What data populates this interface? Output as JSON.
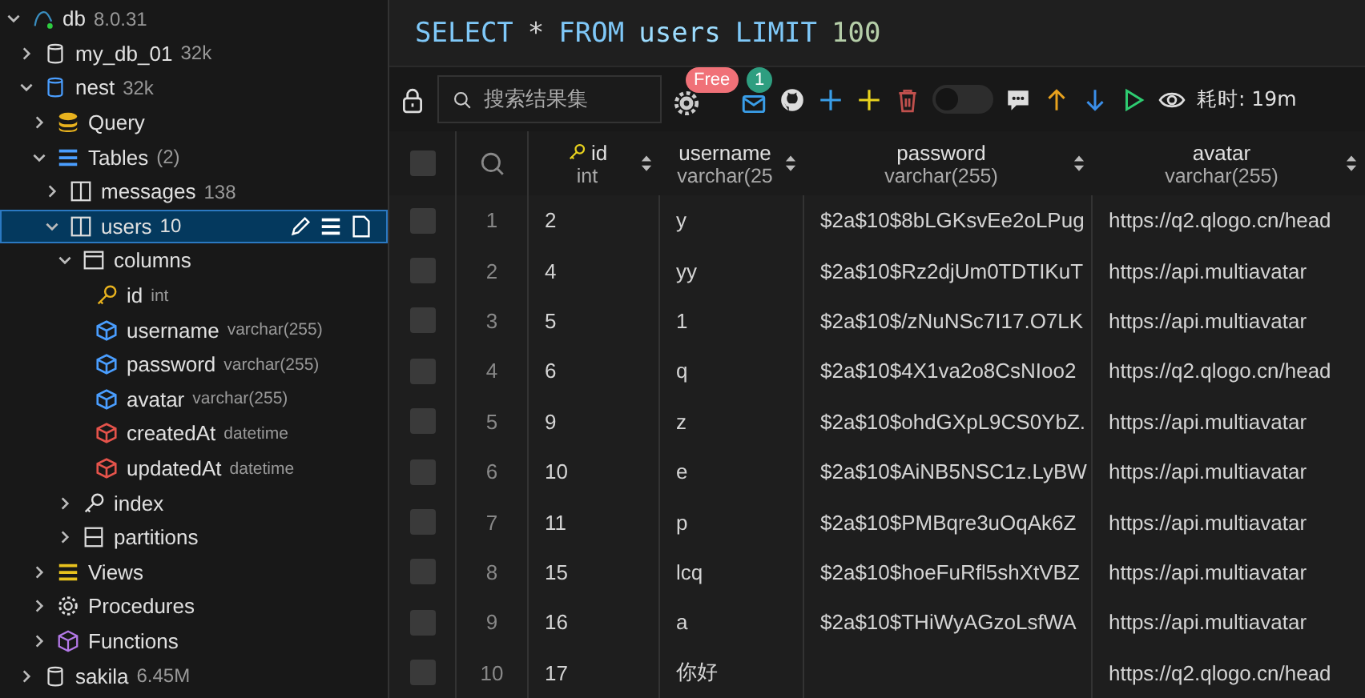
{
  "tree": [
    {
      "label": "db",
      "meta": "8.0.31",
      "kind": "server",
      "expanded": true,
      "selected": false,
      "children": [
        {
          "label": "my_db_01",
          "meta": "32k",
          "kind": "database",
          "expanded": false,
          "selected": false
        },
        {
          "label": "nest",
          "meta": "32k",
          "kind": "database-open",
          "expanded": true,
          "selected": false,
          "children": [
            {
              "label": "Query",
              "kind": "query",
              "expanded": false,
              "selected": false
            },
            {
              "label": "Tables",
              "meta": "(2)",
              "kind": "tables",
              "expanded": true,
              "selected": false,
              "children": [
                {
                  "label": "messages",
                  "meta": "138",
                  "kind": "table",
                  "expanded": false,
                  "selected": false
                },
                {
                  "label": "users",
                  "meta": "10",
                  "kind": "table",
                  "expanded": true,
                  "selected": true,
                  "children": [
                    {
                      "label": "columns",
                      "kind": "columns",
                      "expanded": true,
                      "selected": false,
                      "children": [
                        {
                          "label": "id",
                          "meta": "int",
                          "kind": "primary",
                          "selected": false
                        },
                        {
                          "label": "username",
                          "meta": "varchar(255)",
                          "kind": "field",
                          "color": "#4a9eff",
                          "selected": false
                        },
                        {
                          "label": "password",
                          "meta": "varchar(255)",
                          "kind": "field",
                          "color": "#4a9eff",
                          "selected": false
                        },
                        {
                          "label": "avatar",
                          "meta": "varchar(255)",
                          "kind": "field",
                          "color": "#4a9eff",
                          "selected": false
                        },
                        {
                          "label": "createdAt",
                          "meta": "datetime",
                          "kind": "field",
                          "color": "#e5534b",
                          "selected": false
                        },
                        {
                          "label": "updatedAt",
                          "meta": "datetime",
                          "kind": "field",
                          "color": "#e5534b",
                          "selected": false
                        }
                      ]
                    },
                    {
                      "label": "index",
                      "kind": "index",
                      "expanded": false,
                      "selected": false
                    },
                    {
                      "label": "partitions",
                      "kind": "partitions",
                      "expanded": false,
                      "selected": false
                    }
                  ]
                }
              ]
            },
            {
              "label": "Views",
              "kind": "views",
              "expanded": false,
              "selected": false
            },
            {
              "label": "Procedures",
              "kind": "procedures",
              "expanded": false,
              "selected": false
            },
            {
              "label": "Functions",
              "kind": "functions",
              "expanded": false,
              "selected": false
            }
          ]
        },
        {
          "label": "sakila",
          "meta": "6.45M",
          "kind": "database",
          "expanded": false,
          "selected": false
        }
      ]
    }
  ],
  "query": [
    {
      "kind": "keyword",
      "text": "SELECT"
    },
    {
      "kind": "op",
      "text": "*"
    },
    {
      "kind": "keyword",
      "text": "FROM"
    },
    {
      "kind": "ident",
      "text": "users"
    },
    {
      "kind": "keyword",
      "text": "LIMIT"
    },
    {
      "kind": "number",
      "text": "100"
    }
  ],
  "toolbar": {
    "search": {
      "placeholder": "搜索结果集"
    },
    "settings_badge": "Free",
    "mail_badge": "1",
    "toggle_on": false,
    "elapsed": "耗时: 19m"
  },
  "select_all_checked": false,
  "columns": [
    {
      "name": "id",
      "type": "int",
      "key": true
    },
    {
      "name": "username",
      "type": "varchar(25",
      "key": false
    },
    {
      "name": "password",
      "type": "varchar(255)",
      "key": false
    },
    {
      "name": "avatar",
      "type": "varchar(255)",
      "key": false
    }
  ],
  "rows": [
    {
      "num": "1",
      "checked": false,
      "cells": [
        "2",
        "y",
        "$2a$10$8bLGKsvEe2oLPug",
        "https://q2.qlogo.cn/head"
      ]
    },
    {
      "num": "2",
      "checked": false,
      "cells": [
        "4",
        "yy",
        "$2a$10$Rz2djUm0TDTIKuT",
        "https://api.multiavatar"
      ]
    },
    {
      "num": "3",
      "checked": false,
      "cells": [
        "5",
        "1",
        "$2a$10$/zNuNSc7I17.O7LK",
        "https://api.multiavatar"
      ]
    },
    {
      "num": "4",
      "checked": false,
      "cells": [
        "6",
        "q",
        "$2a$10$4X1va2o8CsNIoo2",
        "https://q2.qlogo.cn/head"
      ]
    },
    {
      "num": "5",
      "checked": false,
      "cells": [
        "9",
        "z",
        "$2a$10$ohdGXpL9CS0YbZ.",
        "https://api.multiavatar"
      ]
    },
    {
      "num": "6",
      "checked": false,
      "cells": [
        "10",
        "e",
        "$2a$10$AiNB5NSC1z.LyBW",
        "https://api.multiavatar"
      ]
    },
    {
      "num": "7",
      "checked": false,
      "cells": [
        "11",
        "p",
        "$2a$10$PMBqre3uOqAk6Z",
        "https://api.multiavatar"
      ]
    },
    {
      "num": "8",
      "checked": false,
      "cells": [
        "15",
        "lcq",
        "$2a$10$hoeFuRfl5shXtVBZ",
        "https://api.multiavatar"
      ]
    },
    {
      "num": "9",
      "checked": false,
      "cells": [
        "16",
        "a",
        "$2a$10$THiWyAGzoLsfWA",
        "https://api.multiavatar"
      ]
    },
    {
      "num": "10",
      "checked": false,
      "cells": [
        "17",
        "你好",
        "",
        "https://q2.qlogo.cn/head"
      ]
    }
  ]
}
